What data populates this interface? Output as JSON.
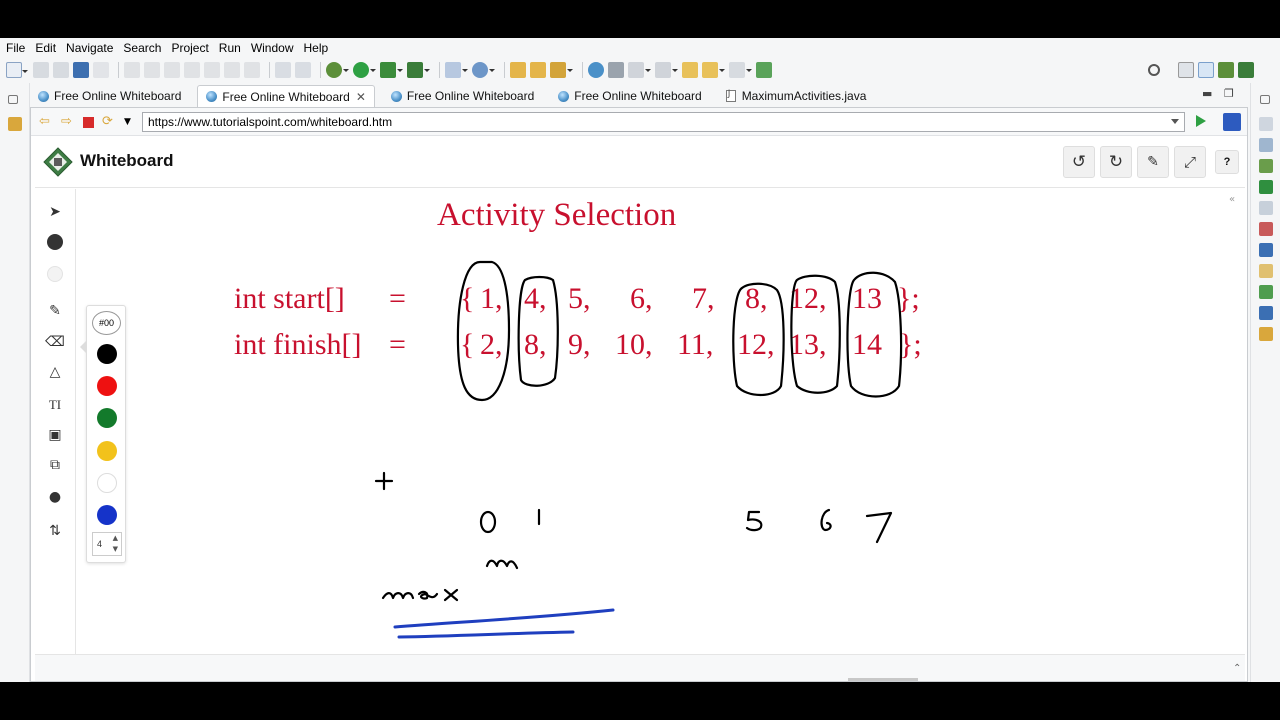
{
  "menu": [
    "File",
    "Edit",
    "Navigate",
    "Search",
    "Project",
    "Run",
    "Window",
    "Help"
  ],
  "tabs": [
    {
      "label": "Free Online Whiteboard",
      "active": false,
      "icon": "globe-icon"
    },
    {
      "label": "Free Online Whiteboard",
      "active": true,
      "icon": "globe-icon"
    },
    {
      "label": "Free Online Whiteboard",
      "active": false,
      "icon": "globe-icon"
    },
    {
      "label": "Free Online Whiteboard",
      "active": false,
      "icon": "globe-icon"
    },
    {
      "label": "MaximumActivities.java",
      "active": false,
      "icon": "java-file-icon"
    }
  ],
  "browser": {
    "url": "https://www.tutorialspoint.com/whiteboard.htm"
  },
  "whiteboard": {
    "title": "Whiteboard",
    "color_code": "#00",
    "line_width": "4"
  },
  "palette": {
    "colors": [
      "#000000",
      "#ee1111",
      "#137a2b",
      "#f2c21b",
      "#ffffff",
      "#1533c9"
    ]
  },
  "canvas": {
    "heading": "Activity Selection",
    "start_label": "int start[]",
    "finish_label": "int finish[]",
    "equals": "=",
    "start_values": [
      "1,",
      "4,",
      "5,",
      "6,",
      "7,",
      "8,",
      "12,",
      "13"
    ],
    "finish_values": [
      "2,",
      "8,",
      "9,",
      "10,",
      "11,",
      "12,",
      "13,",
      "14"
    ],
    "open_brace": "{",
    "close_brace": "};",
    "index_labels": [
      "0",
      "1",
      "5",
      "6",
      "7"
    ],
    "handwritten_note": "max",
    "handwritten_superscript": "m",
    "text_color": "#c8102e",
    "ink_color": "#000000",
    "underline_color": "#1f3fbf"
  }
}
